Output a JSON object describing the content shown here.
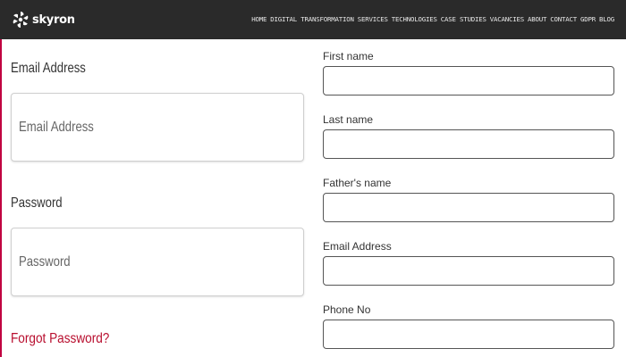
{
  "brand": {
    "name": "skyron",
    "logo_icon": "skyron-logo-icon"
  },
  "nav": {
    "items": [
      "HOME",
      "DIGITAL TRANSFORMATION",
      "SERVICES",
      "TECHNOLOGIES",
      "CASE STUDIES",
      "VACANCIES",
      "ABOUT",
      "CONTACT",
      "GDPR",
      "BLOG"
    ]
  },
  "login": {
    "email_label": "Email Address",
    "email_placeholder": "Email Address",
    "password_label": "Password",
    "password_placeholder": "Password",
    "forgot_link": "Forgot Password?"
  },
  "register": {
    "first_name_label": "First name",
    "last_name_label": "Last name",
    "fathers_name_label": "Father's name",
    "email_label": "Email Address",
    "phone_label": "Phone No"
  },
  "colors": {
    "topbar": "#2a2a2a",
    "accent": "#b80e2e"
  }
}
